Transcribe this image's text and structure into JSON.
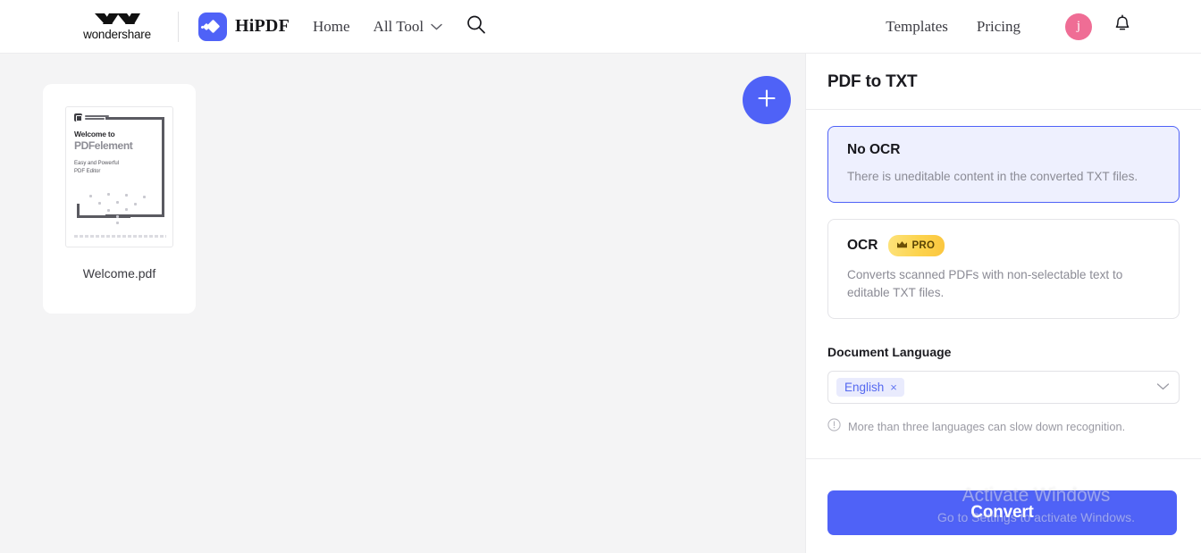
{
  "header": {
    "brand_word": "wondershare",
    "app_name": "HiPDF",
    "nav": [
      {
        "label": "Home",
        "name": "home"
      },
      {
        "label": "All Tool",
        "name": "all-tool"
      }
    ],
    "search_icon": "search-icon",
    "right_links": [
      {
        "label": "Templates",
        "name": "templates"
      },
      {
        "label": "Pricing",
        "name": "pricing"
      }
    ],
    "avatar_initial": "j",
    "avatar_color": "#ef6d95",
    "bell_icon": "bell-icon"
  },
  "workspace": {
    "file": {
      "name": "Welcome.pdf",
      "thumbnail": {
        "logo_text_line1": "Wondershare",
        "logo_text_line2": "PDFelement",
        "heading1": "Welcome to",
        "heading2": "PDFelement",
        "sub_line1": "Easy and Powerful",
        "sub_line2": "PDF Editor"
      }
    },
    "add_button_label": "+"
  },
  "panel": {
    "title": "PDF to TXT",
    "options": [
      {
        "title": "No OCR",
        "description": "There is uneditable content in the converted TXT files.",
        "selected": true,
        "badge": null
      },
      {
        "title": "OCR",
        "description": "Converts scanned PDFs with non-selectable text to editable TXT files.",
        "selected": false,
        "badge": "PRO"
      }
    ],
    "language": {
      "label": "Document Language",
      "selected": "English",
      "remove_label": "×",
      "hint": "More than three languages can slow down recognition."
    },
    "convert_label": "Convert"
  },
  "watermark": {
    "line1": "Activate Windows",
    "line2": "Go to Settings to activate Windows."
  },
  "colors": {
    "accent": "#4f62f7",
    "selected_card_bg": "#eef0fe",
    "pro_badge": "#fcd34d",
    "avatar": "#ef6d95",
    "page_bg": "#f4f4f5"
  }
}
